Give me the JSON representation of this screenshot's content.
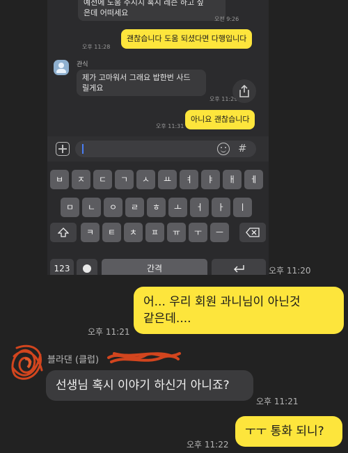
{
  "inner_chat": {
    "top_partial_line1": "예전에 도움 주시지 혹시 레슨 하고 싶",
    "top_partial_line2": "은데 어떠세요",
    "top_partial_time": "오전 9:26",
    "msg1_text": "괜찮습니다 도움 되셨다면 다행입니다",
    "msg1_time": "오후 11:28",
    "sender_name": "관식",
    "msg2_line1": "제가 고마워서 그래요 밥한번 사드",
    "msg2_line2": "릴게요",
    "msg2_time": "오후 11:29",
    "msg3_text": "아니요 괜찮습니다",
    "msg3_time": "오후 11:31",
    "share_icon": "share-icon",
    "plus_icon": "plus-icon",
    "emoji_icon": "emoji-icon",
    "hash_label": "#"
  },
  "keyboard": {
    "row1": [
      "ㅂ",
      "ㅈ",
      "ㄷ",
      "ㄱ",
      "ㅅ",
      "ㅛ",
      "ㅕ",
      "ㅑ",
      "ㅐ",
      "ㅔ"
    ],
    "row2": [
      "ㅁ",
      "ㄴ",
      "ㅇ",
      "ㄹ",
      "ㅎ",
      "ㅗ",
      "ㅓ",
      "ㅏ",
      "ㅣ"
    ],
    "row3": [
      "ㅋ",
      "ㅌ",
      "ㅊ",
      "ㅍ",
      "ㅠ",
      "ㅜ",
      "ㅡ"
    ],
    "shift_icon": "shift-icon",
    "backspace_icon": "backspace-icon",
    "numbers_label": "123",
    "space_label": "간격",
    "return_icon": "return-icon"
  },
  "outer_chat": {
    "time_after_screenshot": "오후 11:20",
    "msg_a_line1": "어... 우리 회원 과니님이 아닌것",
    "msg_a_line2": "같은데....",
    "msg_a_time": "오후 11:21",
    "sender_name": "블라댄 (클럽)",
    "msg_b_text": "선생님 혹시 이야기 하신거 아니죠?",
    "msg_b_time": "오후 11:21",
    "msg_c_text": "ㅜㅜ 통화 되니?",
    "msg_c_time": "오후 11:22"
  },
  "colors": {
    "background": "#222222",
    "yellow_bubble": "#fde53c",
    "dark_bubble": "#3b3b3d",
    "scribble": "#d2451e"
  }
}
